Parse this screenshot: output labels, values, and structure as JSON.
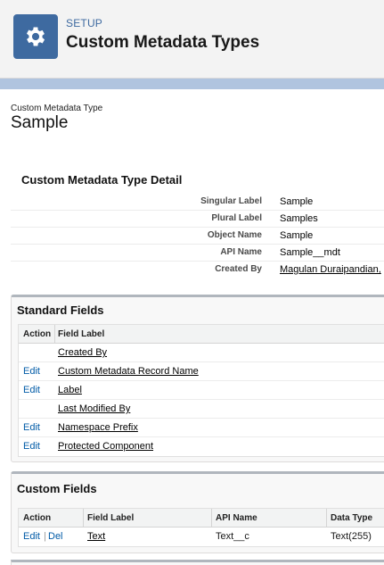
{
  "header": {
    "setup_label": "SETUP",
    "title": "Custom Metadata Types",
    "icon": "gear-icon",
    "icon_bg": "#3e6aa0"
  },
  "record": {
    "caption": "Custom Metadata Type",
    "name": "Sample"
  },
  "detail": {
    "title": "Custom Metadata Type Detail",
    "rows": [
      {
        "label": "Singular Label",
        "value": "Sample"
      },
      {
        "label": "Plural Label",
        "value": "Samples"
      },
      {
        "label": "Object Name",
        "value": "Sample"
      },
      {
        "label": "API Name",
        "value": "Sample__mdt"
      },
      {
        "label": "Created By",
        "value": "Magulan Duraipandian,"
      }
    ]
  },
  "standard_fields": {
    "title": "Standard Fields",
    "col_action": "Action",
    "col_label": "Field Label",
    "rows": [
      {
        "action": "",
        "label": "Created By"
      },
      {
        "action": "Edit",
        "label": "Custom Metadata Record Name"
      },
      {
        "action": "Edit",
        "label": "Label"
      },
      {
        "action": "",
        "label": "Last Modified By"
      },
      {
        "action": "Edit",
        "label": "Namespace Prefix"
      },
      {
        "action": "Edit",
        "label": "Protected Component"
      }
    ]
  },
  "custom_fields": {
    "title": "Custom Fields",
    "col_action": "Action",
    "col_label": "Field Label",
    "col_api": "API Name",
    "col_type": "Data Type",
    "rows": [
      {
        "edit": "Edit",
        "sep": "|",
        "del": "Del",
        "label": "Text",
        "api": "Text__c",
        "type": "Text(255)"
      }
    ]
  }
}
